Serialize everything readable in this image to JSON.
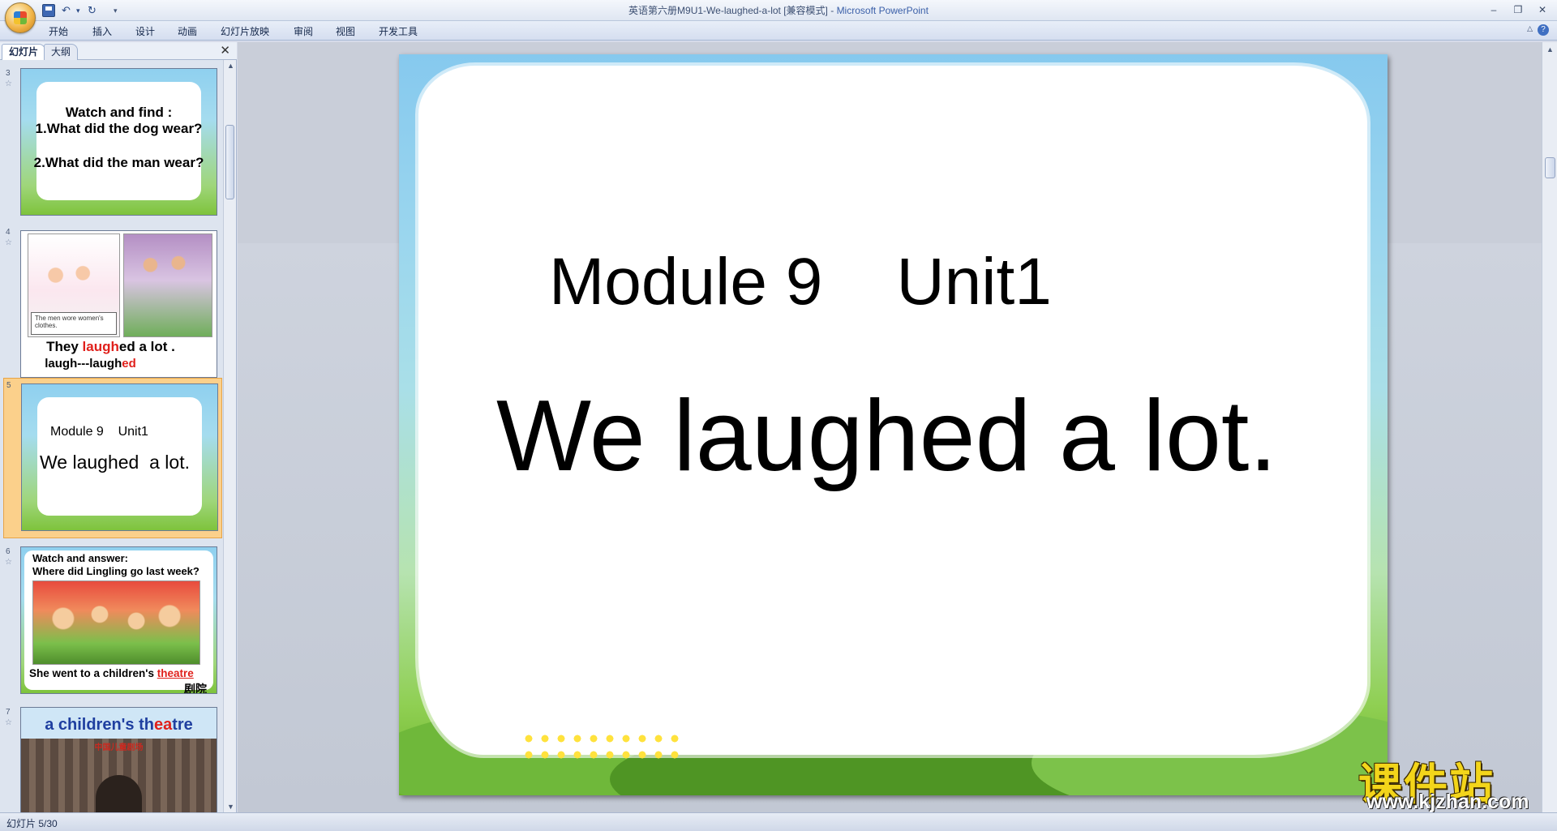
{
  "window": {
    "doc_title": "英语第六册M9U1-We-laughed-a-lot [兼容模式]",
    "separator": " - ",
    "app_name": "Microsoft PowerPoint"
  },
  "qat": {
    "undo": "↶",
    "undo_arrow": "▾",
    "redo": "↻",
    "more": "▾"
  },
  "window_controls": [
    "–",
    "❐",
    "✕"
  ],
  "ribbon": {
    "tabs": [
      "开始",
      "插入",
      "设计",
      "动画",
      "幻灯片放映",
      "审阅",
      "视图",
      "开发工具"
    ],
    "help": "?",
    "minimize": "△"
  },
  "pane": {
    "tab_slides": "幻灯片",
    "tab_outline": "大纲",
    "close": "✕"
  },
  "thumbnails": [
    {
      "number": "3",
      "lines": [
        "Watch and find :",
        "1.What did the dog wear?",
        "2.What did the man wear?"
      ]
    },
    {
      "number": "4",
      "caption": "The men wore women's clothes.",
      "line1_a": "They ",
      "line1_red": "laugh",
      "line1_b": "ed a lot .",
      "line2_a": "laugh---laugh",
      "line2_red": "ed"
    },
    {
      "number": "5",
      "module": "Module 9    Unit1",
      "title": "We laughed  a lot."
    },
    {
      "number": "6",
      "q1": "Watch and answer:",
      "q2": "Where did Lingling go last week?",
      "ans_a": "She went to a children's ",
      "ans_red": "theatre",
      "ans_cn": "剧院"
    },
    {
      "number": "7",
      "title_a": "a children's th",
      "title_red": "ea",
      "title_b": "tre",
      "sign": "中国儿童剧场"
    }
  ],
  "slide": {
    "module": "Module 9    Unit1",
    "title": "We laughed a lot."
  },
  "watermark": {
    "cn": "课件站",
    "url": "www.kjzhan.com"
  },
  "status": {
    "slide_counter": "幻灯片 5/30"
  },
  "colors": {
    "accent_red": "#e0201b",
    "accent_blue": "#1f3fa0",
    "selected_thumb": "#fbd08b"
  }
}
